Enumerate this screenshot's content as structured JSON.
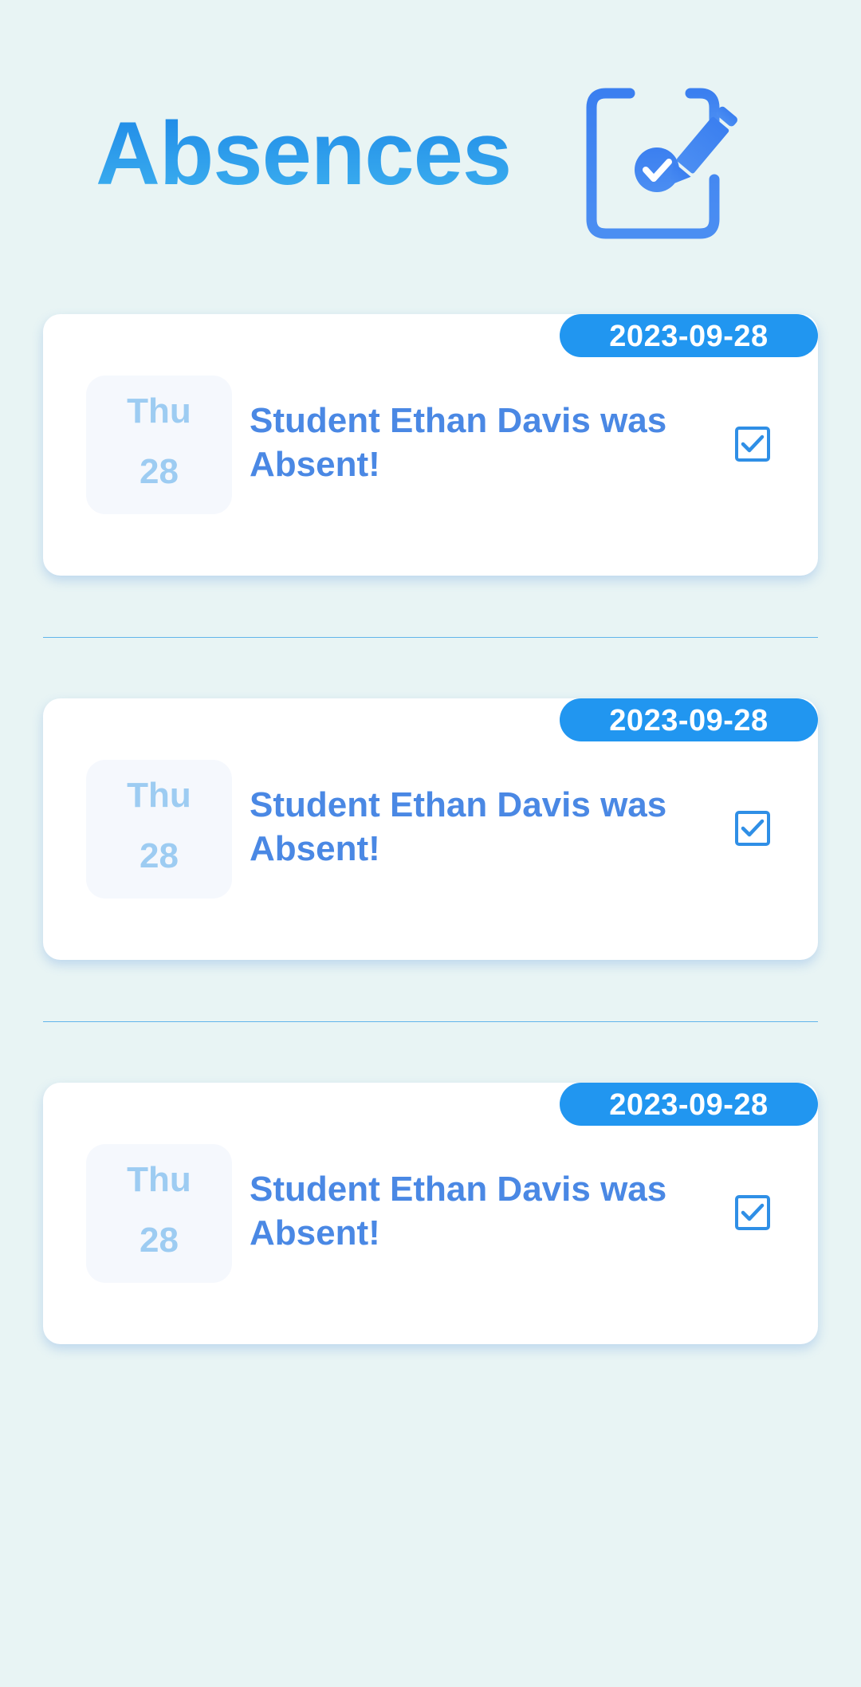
{
  "header": {
    "title": "Absences",
    "icon": "calendar-checklist-edit-icon"
  },
  "colors": {
    "background": "#e8f4f4",
    "accent": "#2196f0",
    "title": "#1f8fe8",
    "message_text": "#4a88e4",
    "day_text": "#9dccf2",
    "divider": "#62b4ea"
  },
  "absences": [
    {
      "date": "2023-09-28",
      "day_name": "Thu",
      "day_number": "28",
      "message": "Student Ethan Davis was Absent!",
      "checked": true
    },
    {
      "date": "2023-09-28",
      "day_name": "Thu",
      "day_number": "28",
      "message": "Student Ethan Davis was Absent!",
      "checked": true
    },
    {
      "date": "2023-09-28",
      "day_name": "Thu",
      "day_number": "28",
      "message": "Student Ethan Davis was Absent!",
      "checked": true
    }
  ]
}
